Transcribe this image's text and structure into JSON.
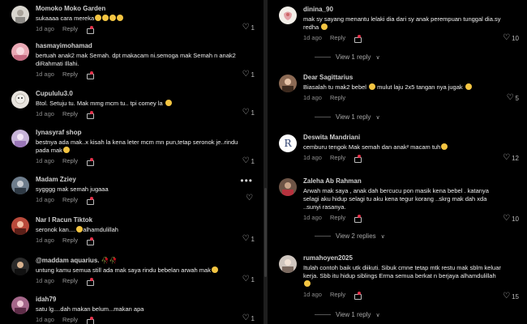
{
  "left": [
    {
      "name": "Momoko Moko Garden",
      "text": "sukaaaa cara mereka",
      "emoji_count": 4,
      "date": "1d ago",
      "reply": "Reply",
      "likes": "1"
    },
    {
      "name": "hasmayimohamad",
      "text": "bertuah anak2 mak Semah. dpt makacam ni.semoga mak Semah n anak2 diRahmati Illahi.",
      "date": "1d ago",
      "reply": "Reply",
      "likes": "1"
    },
    {
      "name": "Cupululu3.0",
      "text": "Btol. Setuju tu. Mak mmg mcm tu.. tpi comey la",
      "emoji_count": 1,
      "date": "1d ago",
      "reply": "Reply",
      "likes": "1"
    },
    {
      "name": "lynasyraf shop",
      "text": "bestnya ada mak..x kisah la kena leter mcm mn pun,tetap seronok je..rindu pada mak",
      "emoji_count": 1,
      "date": "1d ago",
      "reply": "Reply",
      "likes": "1"
    },
    {
      "name": "Madam Zziey",
      "text": "sygggg mak semah jugaaa",
      "date": "1d ago",
      "reply": "Reply",
      "likes": ""
    },
    {
      "name": "Nar I Racun Tiktok",
      "text": "seronok kan....",
      "text2": "alhamdulillah",
      "date": "1d ago",
      "reply": "Reply",
      "likes": "1"
    },
    {
      "name": "@maddam aquarius.",
      "text": "untung kamu semua still ada mak saya rindu bebelan arwah mak",
      "emoji_count": 1,
      "date": "1d ago",
      "reply": "Reply",
      "likes": "1"
    },
    {
      "name": "idah79",
      "text": "satu lg....dah makan belum...makan apa",
      "date": "1d ago",
      "reply": "Reply",
      "likes": "1"
    }
  ],
  "right": [
    {
      "name": "dinina_90",
      "text": "mak sy sayang menantu lelaki dia dari sy anak perempuan tunggal dia.sy redha",
      "emoji_count": 1,
      "date": "1d ago",
      "reply": "Reply",
      "likes": "10"
    },
    {
      "name": "Dear Sagittarius",
      "text": "Biasalah tu mak2 bebel",
      "text2": "mulut laju 2x5 tangan nya jugak",
      "date": "1d ago",
      "reply": "Reply",
      "likes": "5"
    },
    {
      "name": "Deswita Mandriani",
      "text": "cemburu tengok Mak semah dan anak² macam tuh",
      "emoji_count": 1,
      "date": "1d ago",
      "reply": "Reply",
      "likes": "12"
    },
    {
      "name": "Zaleha Ab Rahman",
      "text": "Arwah mak saya , anak dah bercucu pon masik kena bebel . katanya selagi aku hidup selagi tu aku kena tegur korang ..skrg mak dah xda ..sunyi rasanya.",
      "date": "1d ago",
      "reply": "Reply",
      "likes": "10"
    },
    {
      "name": "rumahoyen2025",
      "text": "Itulah contoh baik utk diikuti. Sibuk cmne tetap mtk restu mak sblm keluar kerja. Sbb itu hidup siblings Erma semua berkat n berjaya alhamdulillah",
      "emoji_count": 1,
      "date": "1d ago",
      "reply": "Reply",
      "likes": "15"
    }
  ],
  "view_replies": [
    "View 1 reply",
    "View 1 reply",
    "View 2 replies",
    "View 1 reply"
  ],
  "colors": {
    "background": "#000000",
    "text": "#f0f0f0",
    "muted": "#8a8a8a"
  }
}
